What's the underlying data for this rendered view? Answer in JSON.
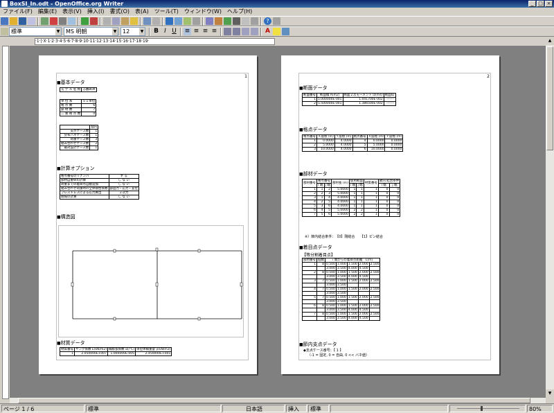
{
  "window": {
    "title": "BoxSI_In.odt - OpenOffice.org Writer",
    "controls": [
      "_",
      "□",
      "×"
    ]
  },
  "menu": [
    "ファイル(F)",
    "編集(E)",
    "表示(V)",
    "挿入(I)",
    "書式(O)",
    "表(A)",
    "ツール(T)",
    "ウィンドウ(W)",
    "ヘルプ(H)"
  ],
  "toolbar2": {
    "style": "標準",
    "font": "MS 明朝",
    "size": "12"
  },
  "ruler": {
    "text": "·1·|·X·1·2·3·4·5·6·7·8·9·10·11·12·13·14·15·16·17·18·19·"
  },
  "page1": {
    "page_number": "1",
    "sec_basic": "基本データ",
    "model_label": "モ デ ル 名 称",
    "model_value": "ふ番BOX",
    "units": [
      [
        "単 位 系",
        "ＳＩ単位"
      ],
      [
        "格 点 数",
        "6"
      ],
      [
        "部 材 数",
        "7"
      ],
      [
        "二 重 格 点 数",
        "0"
      ]
    ],
    "cases_header": "個内",
    "cases": [
      [
        "支点ケース数",
        "1"
      ],
      [
        "分布ハネケース数",
        "1"
      ],
      [
        "荷重ケース数",
        "3"
      ],
      [
        "組み合わせケース数",
        "2"
      ],
      [
        "最対設計ケース数",
        "1"
      ]
    ],
    "sec_options": "計算オプション",
    "options": [
      [
        "格点番号のリナンバ",
        "す る"
      ],
      [
        "部材自重Wの計算",
        "し な い"
      ],
      [
        "荷重までの着目点自動追加",
        "し な い"
      ],
      [
        "組み合わせ荷重時の全体剛性係数",
        "部固力・応力・変位"
      ],
      [
        "プレストレスによる応力算出",
        "２次力"
      ],
      [
        "剛域の計算",
        "し な い"
      ]
    ],
    "sec_structure": "構造図",
    "sec_material": "材質データ",
    "material_headers": [
      "材質番号",
      "ヤング係数\nE(kN/m2)",
      "線膨張係数\nα(/℃)",
      "単位体積重量\nγ(kN/m3)"
    ],
    "material_rows": [
      [
        "1",
        "2.050000E+007",
        "1.000000E-005",
        "2.450000E+001"
      ]
    ]
  },
  "page2": {
    "page_number": "2",
    "sec_section": "断面データ",
    "section_headers": [
      "断面番号",
      "断面積\nA(m2)",
      "断面２次モーメント\nIz(m4)",
      "断面ID"
    ],
    "section_rows": [
      [
        "1",
        "5.000000E-001",
        "1.041700E-002",
        "-------"
      ],
      [
        "2",
        "5.500000E-001",
        "1.386500E-002",
        "-------"
      ]
    ],
    "sec_nodes": "格点データ",
    "node_headers": [
      "格点番号",
      "Ｘ座標\n(m)",
      "Ｙ座標\n(m)",
      "格点番号",
      "Ｘ座標\n(m)",
      "Ｙ座標\n(m)"
    ],
    "node_rows": [
      [
        "1",
        "0.0000",
        "4.0000",
        "4",
        "0.0000",
        "0.0000"
      ],
      [
        "2",
        "5.0000",
        "4.0000",
        "5",
        "5.0000",
        "0.0000"
      ],
      [
        "3",
        "10.0000",
        "4.0000",
        "6",
        "10.0000",
        "0.0000"
      ]
    ],
    "sec_members": "部材データ",
    "member_headers": [
      "部材番号",
      "格点番号",
      "",
      "部材長\n(m)",
      "使用断面",
      "",
      "材質番号",
      "節内\n結合条件",
      ""
    ],
    "member_sub": [
      "i 端",
      "j 端",
      "i 端",
      "j 端",
      "i 端",
      "j 端"
    ],
    "member_rows": [
      [
        "1",
        "1",
        "2",
        "5.0000",
        "1",
        "1",
        "1",
        "0",
        "0"
      ],
      [
        "2",
        "2",
        "3",
        "5.0000",
        "1",
        "1",
        "1",
        "0",
        "0"
      ],
      [
        "3",
        "1",
        "4",
        "4.0000",
        "1",
        "1",
        "1",
        "0",
        "0"
      ],
      [
        "4",
        "2",
        "5",
        "4.0000",
        "1",
        "1",
        "1",
        "0",
        "0"
      ],
      [
        "5",
        "3",
        "6",
        "4.0000",
        "1",
        "1",
        "1",
        "0",
        "0"
      ],
      [
        "6",
        "4",
        "5",
        "5.0000",
        "2",
        "2",
        "1",
        "0",
        "0"
      ],
      [
        "7",
        "5",
        "6",
        "5.0000",
        "2",
        "2",
        "1",
        "0",
        "0"
      ]
    ],
    "member_note": "※）節内結合条件：　【0】剛結合　　【1】ピン結合",
    "sec_focus": "着目点データ",
    "focus_sub": "【等分割着目点】",
    "focus_headers": [
      "部材番号",
      "個数",
      "i 端からの着目点距離　L(m)"
    ],
    "focus_rows": [
      [
        "1",
        "8",
        "0.500",
        "1.000",
        "1.500",
        "2.000",
        "2.500"
      ],
      [
        "",
        "",
        "3.000",
        "3.500",
        "4.000",
        "4.500",
        ""
      ],
      [
        "2",
        "8",
        "0.500",
        "1.000",
        "1.500",
        "2.000",
        "2.500"
      ],
      [
        "",
        "",
        "3.000",
        "3.500",
        "4.000",
        "4.500",
        ""
      ],
      [
        "3",
        "7",
        "0.500",
        "1.000",
        "1.500",
        "2.000",
        "2.500"
      ],
      [
        "",
        "",
        "3.000",
        "3.500",
        "",
        "",
        ""
      ],
      [
        "4",
        "7",
        "0.500",
        "1.000",
        "1.500",
        "2.000",
        "2.500"
      ],
      [
        "",
        "",
        "3.000",
        "3.500",
        "",
        "",
        ""
      ],
      [
        "5",
        "7",
        "0.500",
        "1.000",
        "1.500",
        "2.000",
        "2.500"
      ],
      [
        "",
        "",
        "3.000",
        "3.500",
        "",
        "",
        ""
      ],
      [
        "6",
        "8",
        "0.500",
        "1.000",
        "1.500",
        "2.000",
        "2.500"
      ],
      [
        "",
        "",
        "3.000",
        "3.500",
        "4.000",
        "4.500",
        ""
      ],
      [
        "7",
        "8",
        "0.500",
        "1.000",
        "1.500",
        "2.000",
        "2.500"
      ],
      [
        "",
        "",
        "3.000",
        "3.500",
        "4.000",
        "4.500",
        ""
      ]
    ],
    "sec_support": "節内支点データ",
    "support_line1": "◆支点ケース番号：【 1 】",
    "support_line2": "（-1 = 固定, 0 = 自由, 0 << バネ値）"
  },
  "status": {
    "page": "ページ 1 / 6",
    "style": "標準",
    "lang": "日本語",
    "mode": "挿入",
    "std": "標準",
    "zoom": "80%"
  }
}
